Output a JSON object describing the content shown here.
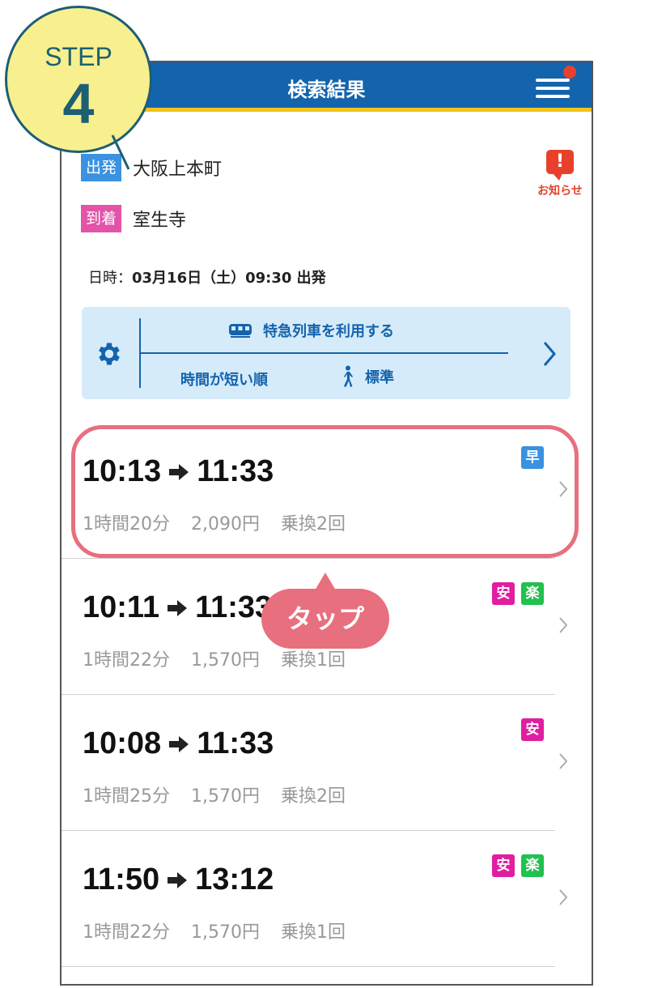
{
  "header": {
    "title": "検索結果"
  },
  "route": {
    "departure": {
      "tag": "出発",
      "station": "大阪上本町"
    },
    "arrival": {
      "tag": "到着",
      "station": "室生寺"
    }
  },
  "notice": {
    "label": "お知らせ",
    "icon": "exclamation-icon"
  },
  "datetime": {
    "label": "日時：",
    "value": "03月16日（土）09:30 出発"
  },
  "options": {
    "express": "特急列車を利用する",
    "sort": "時間が短い順",
    "walk": "標準"
  },
  "results": [
    {
      "depart": "10:13",
      "arrive": "11:33",
      "duration": "1時間20分",
      "fare": "2,090円",
      "transfers": "乗換2回",
      "badges": [
        {
          "text": "早",
          "color": "#3a92e0"
        }
      ]
    },
    {
      "depart": "10:11",
      "arrive": "11:33",
      "duration": "1時間22分",
      "fare": "1,570円",
      "transfers": "乗換1回",
      "badges": [
        {
          "text": "安",
          "color": "#e01fa0"
        },
        {
          "text": "楽",
          "color": "#22c04e"
        }
      ]
    },
    {
      "depart": "10:08",
      "arrive": "11:33",
      "duration": "1時間25分",
      "fare": "1,570円",
      "transfers": "乗換2回",
      "badges": [
        {
          "text": "安",
          "color": "#e01fa0"
        }
      ]
    },
    {
      "depart": "11:50",
      "arrive": "13:12",
      "duration": "1時間22分",
      "fare": "1,570円",
      "transfers": "乗換1回",
      "badges": [
        {
          "text": "安",
          "color": "#e01fa0"
        },
        {
          "text": "楽",
          "color": "#22c04e"
        }
      ]
    }
  ],
  "annotation": {
    "step_label": "STEP",
    "step_number": "4",
    "tap_label": "タップ"
  },
  "colors": {
    "header": "#1463ad",
    "header_accent": "#f0c419",
    "highlight": "#e86f7e",
    "step_fill": "#f8f08f",
    "step_border": "#1d5f72"
  }
}
